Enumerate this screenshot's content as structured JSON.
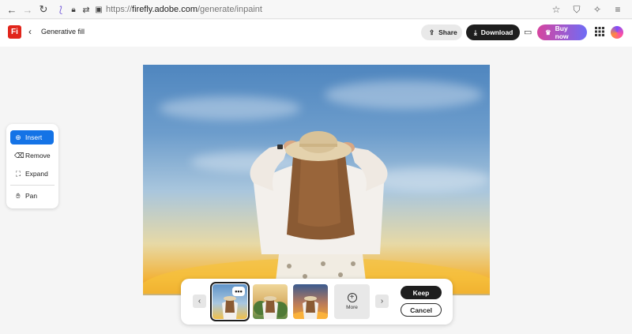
{
  "browser": {
    "url_prefix": "https://",
    "url_host": "firefly.adobe.com",
    "url_path": "/generate/inpaint",
    "icons": [
      "back-arrow-icon",
      "forward-arrow-icon",
      "reload-icon",
      "extension-icon",
      "lock-icon",
      "permissions-icon",
      "page-icon",
      "star-icon",
      "shield-icon",
      "sparkle-icon",
      "menu-icon"
    ]
  },
  "header": {
    "logo": "Fi",
    "title": "Generative fill",
    "share_label": "Share",
    "download_label": "Download",
    "buy_label": "Buy now",
    "colors": {
      "logo": "#e1251b",
      "download_bg": "#1e1e1e",
      "buy_gradient_start": "#d6449f",
      "buy_gradient_end": "#6f6cf5"
    }
  },
  "tools": {
    "items": [
      {
        "label": "Insert",
        "icon": "insert-brush-icon",
        "active": true
      },
      {
        "label": "Remove",
        "icon": "eraser-icon",
        "active": false
      },
      {
        "label": "Expand",
        "icon": "expand-icon",
        "active": false
      },
      {
        "label": "Pan",
        "icon": "hand-icon",
        "active": false
      }
    ],
    "accent": "#1473e6"
  },
  "variations": {
    "count_thumbnails": 3,
    "selected_index": 0,
    "more_label": "More",
    "keep_label": "Keep",
    "cancel_label": "Cancel"
  }
}
